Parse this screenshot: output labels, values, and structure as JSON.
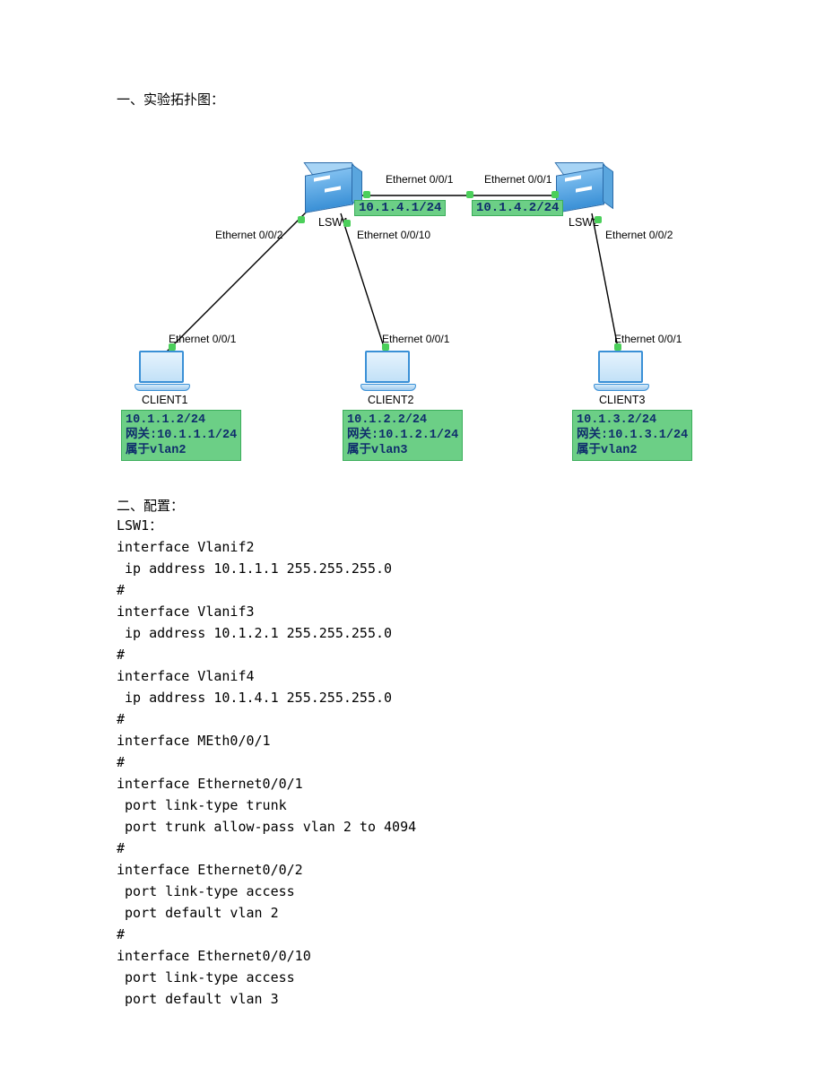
{
  "section1_title": "一、实验拓扑图：",
  "section2_title": "二、配置：",
  "devices": {
    "lsw1": "LSW1",
    "lsw2": "LSW2",
    "client1": "CLIENT1",
    "client2": "CLIENT2",
    "client3": "CLIENT3"
  },
  "ports": {
    "e001_top_left": "Ethernet 0/0/1",
    "e001_top_right": "Ethernet 0/0/1",
    "e002_lsw1": "Ethernet 0/0/2",
    "e0010_lsw1": "Ethernet 0/0/10",
    "e002_lsw2": "Ethernet 0/0/2",
    "e001_c1": "Ethernet 0/0/1",
    "e001_c2": "Ethernet 0/0/1",
    "e001_c3": "Ethernet 0/0/1"
  },
  "link_ips": {
    "lsw1_right": "10.1.4.1/24",
    "lsw2_left": "10.1.4.2/24"
  },
  "clients": {
    "c1": {
      "ip": "10.1.1.2/24",
      "gw": "网关:10.1.1.1/24",
      "vlan": "属于vlan2"
    },
    "c2": {
      "ip": "10.1.2.2/24",
      "gw": "网关:10.1.2.1/24",
      "vlan": "属于vlan3"
    },
    "c3": {
      "ip": "10.1.3.2/24",
      "gw": "网关:10.1.3.1/24",
      "vlan": "属于vlan2"
    }
  },
  "config_header": "LSW1：",
  "config_lines": [
    "interface Vlanif2",
    " ip address 10.1.1.1 255.255.255.0",
    "#",
    "interface Vlanif3",
    " ip address 10.1.2.1 255.255.255.0",
    "#",
    "interface Vlanif4",
    " ip address 10.1.4.1 255.255.255.0",
    "#",
    "interface MEth0/0/1",
    "#",
    "interface Ethernet0/0/1",
    " port link-type trunk",
    " port trunk allow-pass vlan 2 to 4094",
    "#",
    "interface Ethernet0/0/2",
    " port link-type access",
    " port default vlan 2",
    "#",
    "interface Ethernet0/0/10",
    " port link-type access",
    " port default vlan 3"
  ],
  "chart_data": {
    "type": "network-topology",
    "nodes": [
      {
        "id": "LSW1",
        "type": "switch"
      },
      {
        "id": "LSW2",
        "type": "switch"
      },
      {
        "id": "CLIENT1",
        "type": "host",
        "ip": "10.1.1.2/24",
        "gateway": "10.1.1.1/24",
        "vlan": 2
      },
      {
        "id": "CLIENT2",
        "type": "host",
        "ip": "10.1.2.2/24",
        "gateway": "10.1.2.1/24",
        "vlan": 3
      },
      {
        "id": "CLIENT3",
        "type": "host",
        "ip": "10.1.3.2/24",
        "gateway": "10.1.3.1/24",
        "vlan": 2
      }
    ],
    "links": [
      {
        "from": "LSW1",
        "from_port": "Ethernet0/0/1",
        "from_ip": "10.1.4.1/24",
        "to": "LSW2",
        "to_port": "Ethernet0/0/1",
        "to_ip": "10.1.4.2/24"
      },
      {
        "from": "LSW1",
        "from_port": "Ethernet0/0/2",
        "to": "CLIENT1",
        "to_port": "Ethernet0/0/1"
      },
      {
        "from": "LSW1",
        "from_port": "Ethernet0/0/10",
        "to": "CLIENT2",
        "to_port": "Ethernet0/0/1"
      },
      {
        "from": "LSW2",
        "from_port": "Ethernet0/0/2",
        "to": "CLIENT3",
        "to_port": "Ethernet0/0/1"
      }
    ]
  }
}
